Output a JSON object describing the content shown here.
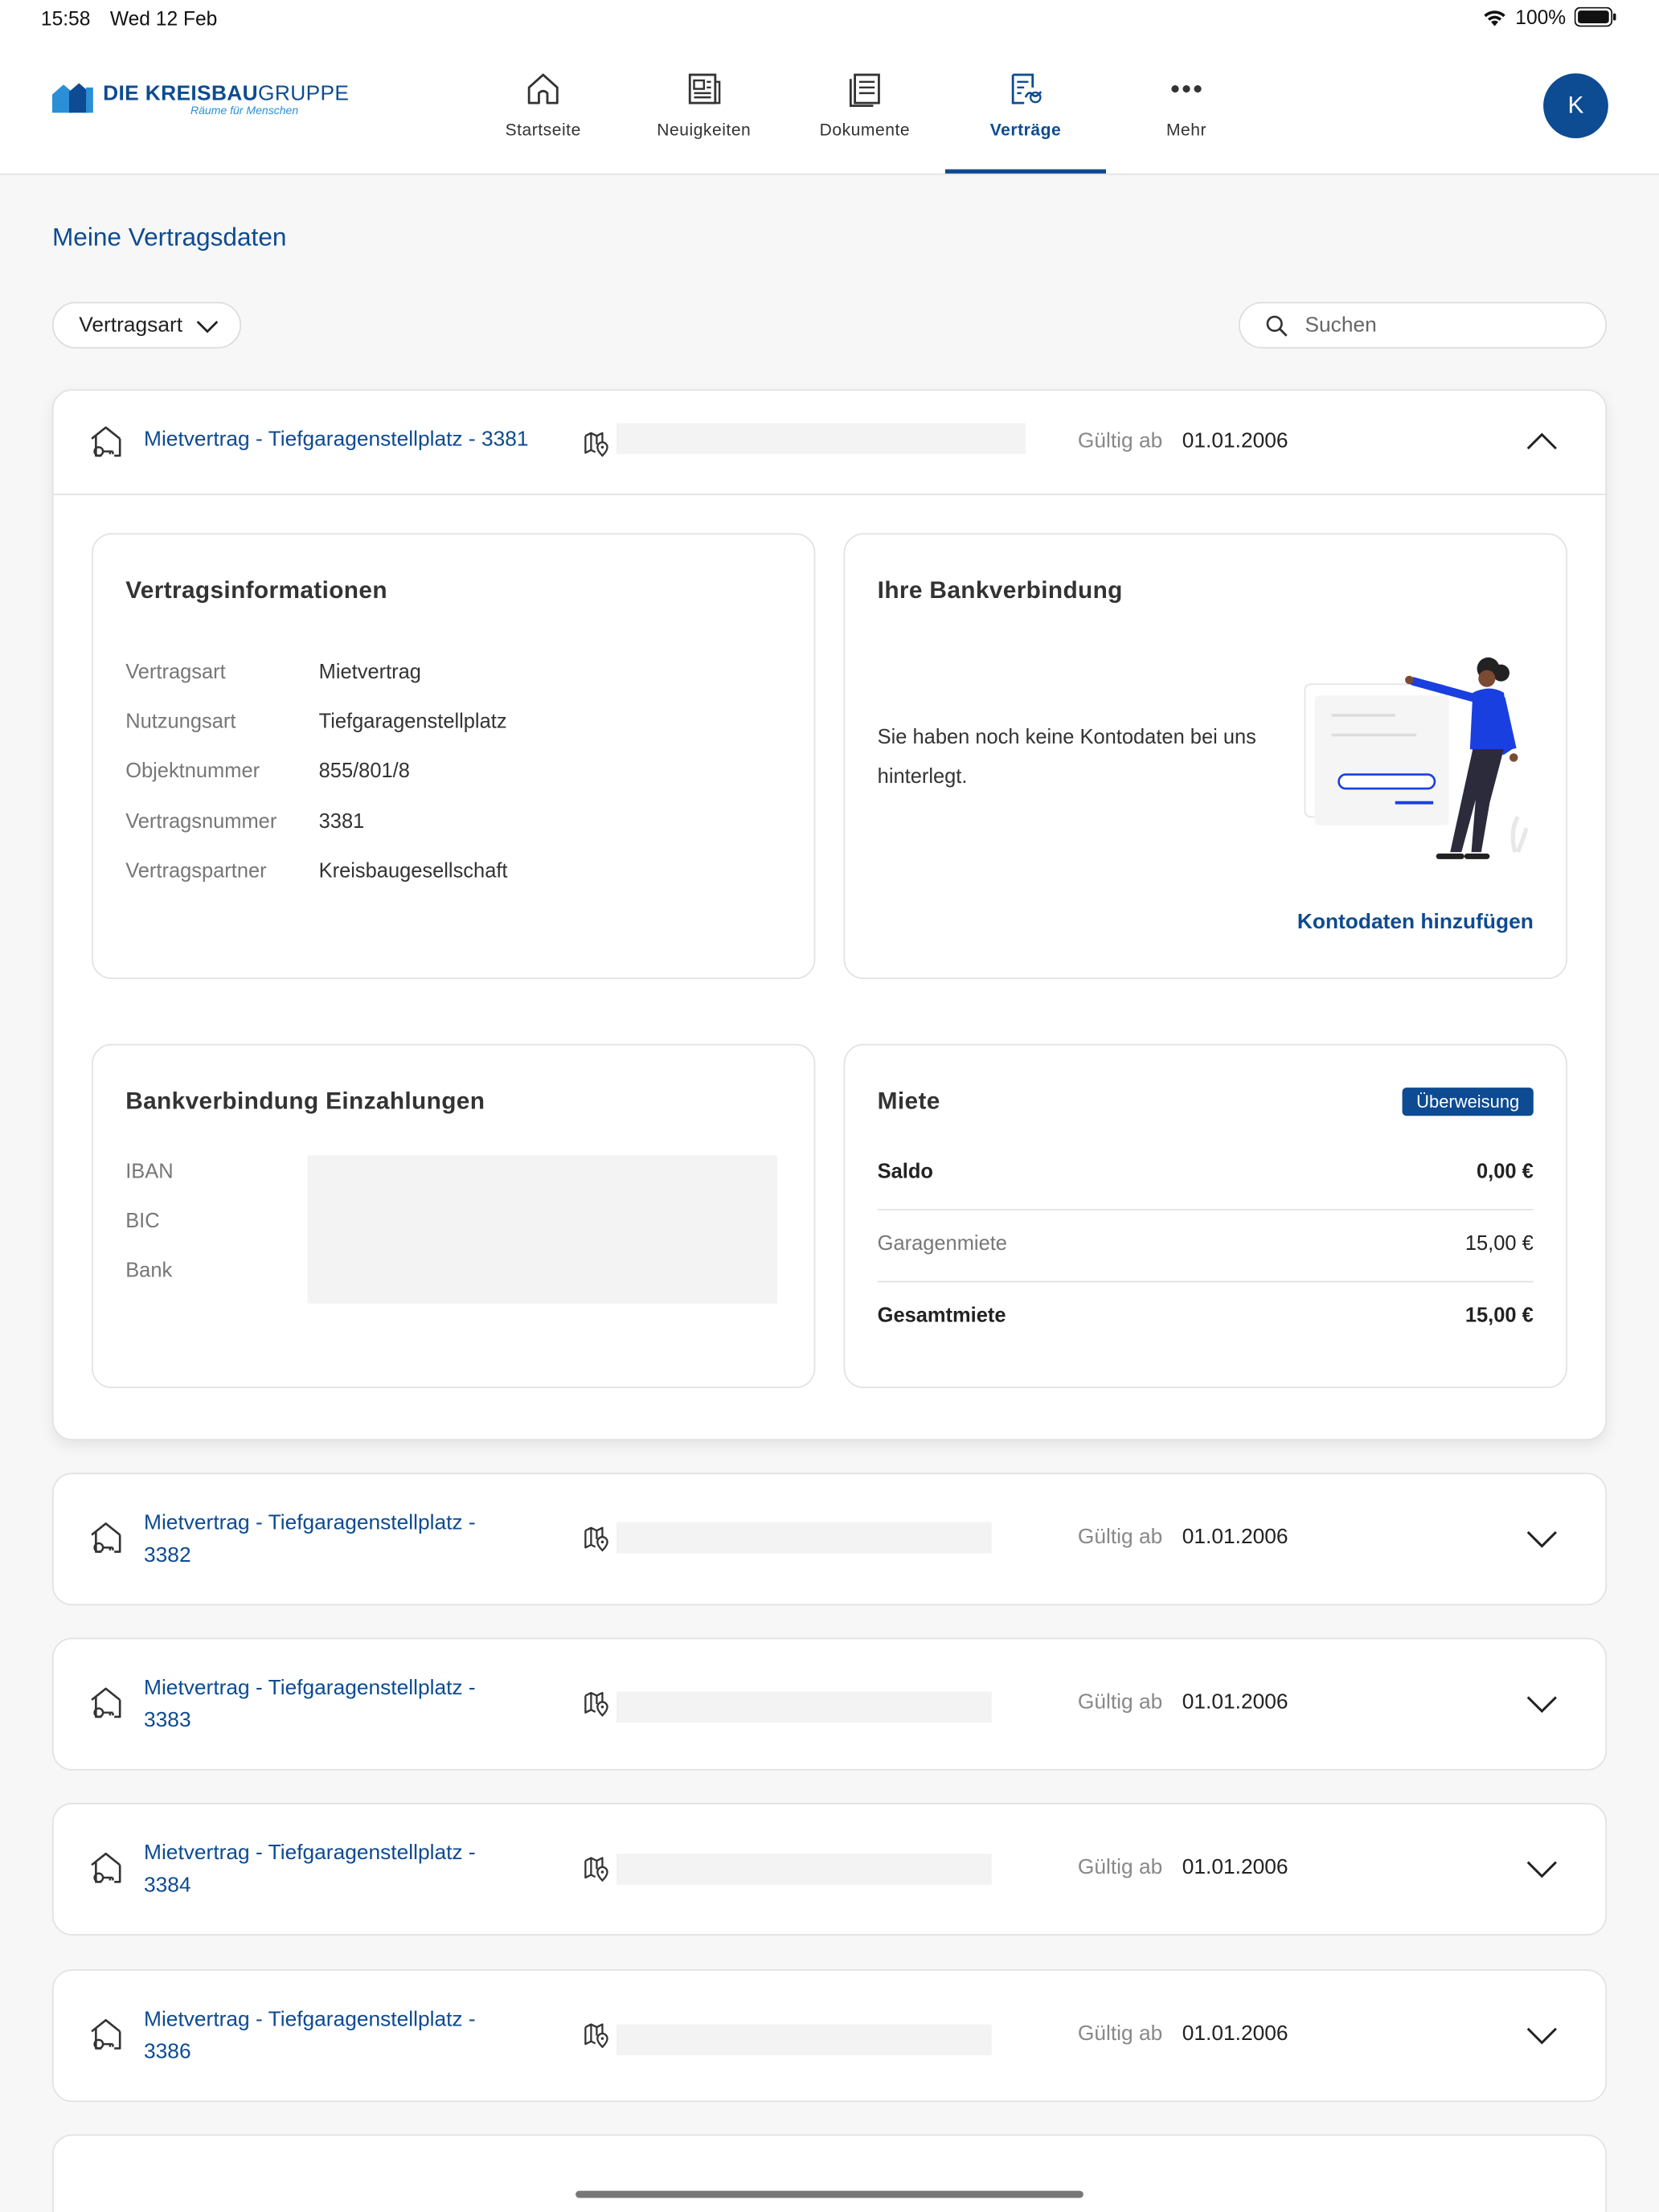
{
  "status_bar": {
    "time": "15:58",
    "date": "Wed 12 Feb",
    "battery": "100%"
  },
  "header": {
    "logo_bold": "DIE KREISBAU",
    "logo_light": "GRUPPE",
    "logo_tagline": "Räume für Menschen",
    "nav": [
      {
        "label": "Startseite",
        "icon": "home-icon"
      },
      {
        "label": "Neuigkeiten",
        "icon": "newspaper-icon"
      },
      {
        "label": "Dokumente",
        "icon": "document-icon"
      },
      {
        "label": "Verträge",
        "icon": "contract-icon",
        "active": true
      },
      {
        "label": "Mehr",
        "icon": "more-icon"
      }
    ],
    "avatar_initial": "K"
  },
  "page_title": "Meine Vertragsdaten",
  "filter": {
    "label": "Vertragsart"
  },
  "search": {
    "placeholder": "Suchen"
  },
  "contracts": [
    {
      "title": "Mietvertrag - Tiefgaragenstellplatz - 3381",
      "valid_label": "Gültig ab",
      "valid_from": "01.01.2006",
      "expanded": true,
      "info": {
        "heading": "Vertragsinformationen",
        "rows": [
          {
            "label": "Vertragsart",
            "value": "Mietvertrag"
          },
          {
            "label": "Nutzungsart",
            "value": "Tiefgaragenstellplatz"
          },
          {
            "label": "Objektnummer",
            "value": "855/801/8"
          },
          {
            "label": "Vertragsnummer",
            "value": "3381"
          },
          {
            "label": "Vertragspartner",
            "value": "Kreisbaugesellschaft"
          }
        ]
      },
      "bank": {
        "heading": "Ihre Bankverbindung",
        "text": "Sie haben noch keine Kontodaten bei uns hinterlegt.",
        "link": "Kontodaten hinzufügen"
      },
      "deposit": {
        "heading": "Bankverbindung Einzahlungen",
        "labels": [
          "IBAN",
          "BIC",
          "Bank"
        ]
      },
      "rent": {
        "heading": "Miete",
        "badge": "Überweisung",
        "rows": [
          {
            "label": "Saldo",
            "value": "0,00 €"
          },
          {
            "label": "Garagenmiete",
            "value": "15,00 €"
          },
          {
            "label": "Gesamtmiete",
            "value": "15,00 €"
          }
        ]
      }
    },
    {
      "title": "Mietvertrag - Tiefgaragenstellplatz - 3382",
      "valid_label": "Gültig ab",
      "valid_from": "01.01.2006"
    },
    {
      "title": "Mietvertrag - Tiefgaragenstellplatz - 3383",
      "valid_label": "Gültig ab",
      "valid_from": "01.01.2006"
    },
    {
      "title": "Mietvertrag - Tiefgaragenstellplatz - 3384",
      "valid_label": "Gültig ab",
      "valid_from": "01.01.2006"
    },
    {
      "title": "Mietvertrag - Tiefgaragenstellplatz - 3386",
      "valid_label": "Gültig ab",
      "valid_from": "01.01.2006"
    }
  ],
  "colors": {
    "brand": "#0d4b92",
    "background": "#f7f7f7",
    "card": "#ffffff",
    "illustration_accent": "#1a3fe0"
  }
}
